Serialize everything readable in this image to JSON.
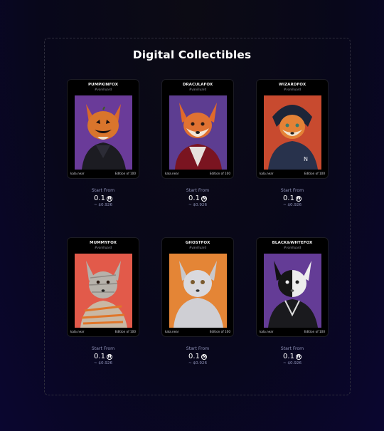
{
  "page": {
    "title": "Digital Collectibles"
  },
  "cards": [
    {
      "name": "PUMPKINFOX",
      "handle": "#vanilluard",
      "owner": "kala.near",
      "edition": "Edition of 100",
      "bg": "#6a3b99",
      "start_label": "Start From",
      "price": "0.1",
      "usd": "~ $0.926"
    },
    {
      "name": "DRACULAFOX",
      "handle": "#vanilluard",
      "owner": "kala.near",
      "edition": "Edition of 100",
      "bg": "#5d3d91",
      "start_label": "Start From",
      "price": "0.1",
      "usd": "~ $0.926"
    },
    {
      "name": "WIZARDFOX",
      "handle": "#vanilluard",
      "owner": "kala.near",
      "edition": "Edition of 100",
      "bg": "#c84a2f",
      "start_label": "Start From",
      "price": "0.1",
      "usd": "~ $0.926"
    },
    {
      "name": "MUMMYFOX",
      "handle": "#vanilluard",
      "owner": "kala.near",
      "edition": "Edition of 100",
      "bg": "#e25a4a",
      "start_label": "Start From",
      "price": "0.1",
      "usd": "~ $0.926"
    },
    {
      "name": "GHOSTFOX",
      "handle": "#vanilluard",
      "owner": "kala.near",
      "edition": "Edition of 100",
      "bg": "#e48536",
      "start_label": "Start From",
      "price": "0.1",
      "usd": "~ $0.926"
    },
    {
      "name": "BLACK&WHTEFOX",
      "handle": "#vanilluard",
      "owner": "kala.near",
      "edition": "Edition of 100",
      "bg": "#643c96",
      "start_label": "Start From",
      "price": "0.1",
      "usd": "~ $0.926"
    }
  ],
  "icons": {
    "currency": "near-icon"
  },
  "near_glyph": "N"
}
